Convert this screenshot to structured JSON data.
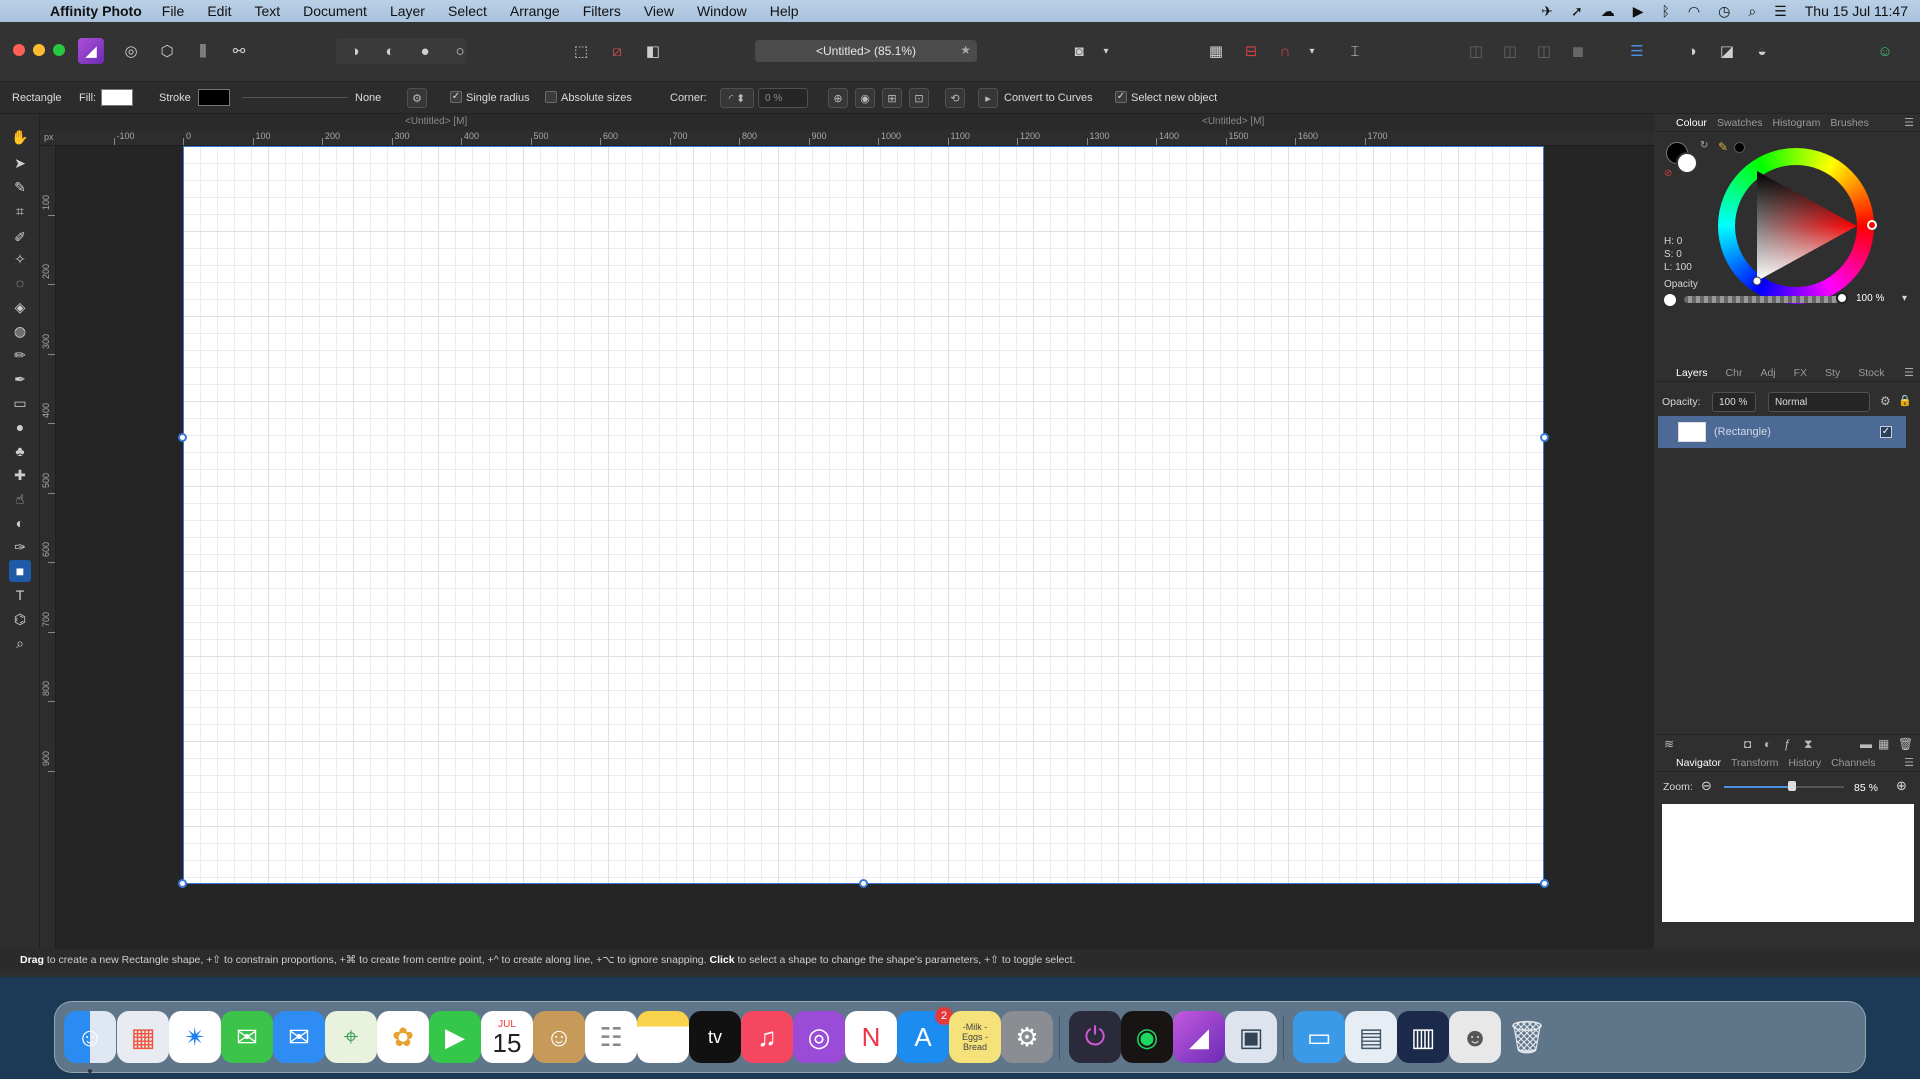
{
  "menubar": {
    "app_name": "Affinity Photo",
    "items": [
      "File",
      "Edit",
      "Text",
      "Document",
      "Layer",
      "Select",
      "Arrange",
      "Filters",
      "View",
      "Window",
      "Help"
    ],
    "clock": "Thu 15 Jul  11:47"
  },
  "toolbar": {
    "document_title": "<Untitled> (85.1%)"
  },
  "context": {
    "tool_label": "Rectangle",
    "fill_label": "Fill:",
    "fill_color": "#ffffff",
    "stroke_label": "Stroke",
    "stroke_color": "#000000",
    "stroke_style": "None",
    "single_radius_label": "Single radius",
    "single_radius_checked": true,
    "absolute_sizes_label": "Absolute sizes",
    "absolute_sizes_checked": false,
    "corner_label": "Corner:",
    "corner_value": "0 %",
    "convert_label": "Convert to Curves",
    "select_new_label": "Select new object",
    "select_new_checked": true
  },
  "doc_tabs": [
    "<Untitled> [M]",
    "<Untitled> [M]"
  ],
  "ruler": {
    "unit": "px",
    "h_ticks": [
      "-100",
      "0",
      "100",
      "200",
      "300",
      "400",
      "500",
      "600",
      "700",
      "800",
      "900",
      "1000",
      "1100",
      "1200",
      "1300",
      "1400",
      "1500",
      "1600",
      "1700"
    ],
    "v_ticks": [
      "100",
      "200",
      "300",
      "400",
      "500",
      "600",
      "700",
      "800",
      "900"
    ]
  },
  "status_bar": {
    "drag": "Drag",
    "text1": " to create a new Rectangle shape, +⇧ to constrain proportions, +⌘ to create from centre point, +^ to create along line, +⌥ to ignore snapping. ",
    "click": "Click",
    "text2": " to select a shape to change the shape's parameters, +⇧ to toggle select."
  },
  "colour_panel": {
    "tabs": [
      "Colour",
      "Swatches",
      "Histogram",
      "Brushes"
    ],
    "h": "H: 0",
    "s": "S: 0",
    "l": "L: 100",
    "opacity_label": "Opacity",
    "opacity_value": "100 %"
  },
  "layers_panel": {
    "tabs": [
      "Layers",
      "Chr",
      "Adj",
      "FX",
      "Sty",
      "Stock"
    ],
    "opacity_label": "Opacity:",
    "opacity_value": "100 %",
    "blend_mode": "Normal",
    "layers": [
      {
        "name": "(Rectangle)",
        "visible": true
      }
    ]
  },
  "navigator_panel": {
    "tabs": [
      "Navigator",
      "Transform",
      "History",
      "Channels"
    ],
    "zoom_label": "Zoom:",
    "zoom_value": "85 %",
    "zoom_level": 0.85
  },
  "dock": {
    "calendar_month": "JUL",
    "calendar_day": "15",
    "appstore_badge": "2",
    "stickies_text": "-Milk -Eggs -Bread"
  }
}
